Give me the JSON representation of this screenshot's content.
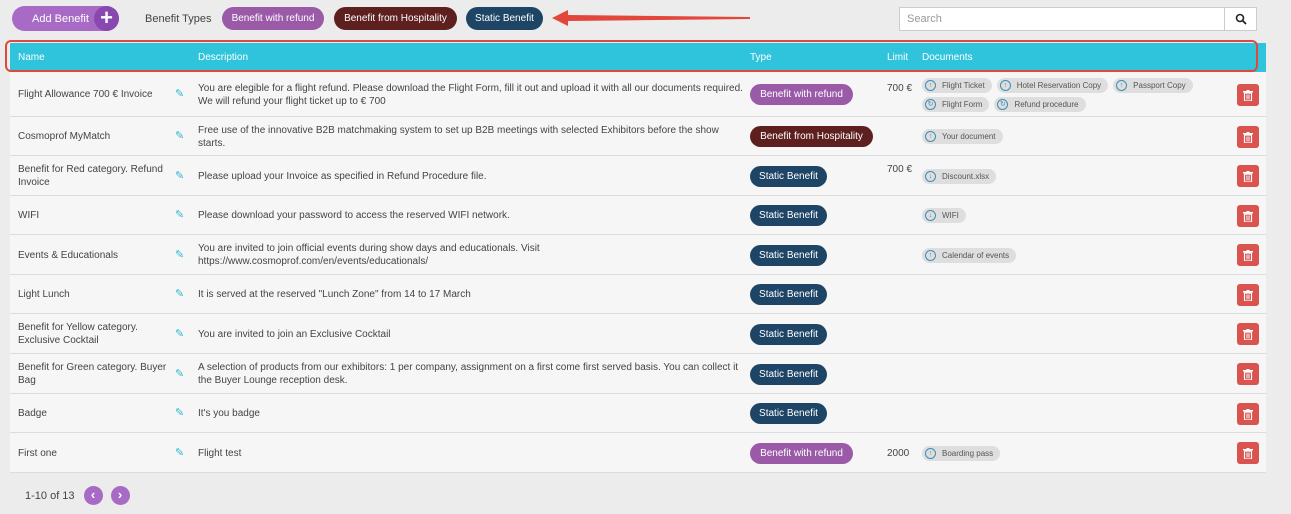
{
  "toolbar": {
    "add_label": "Add Benefit",
    "types_label": "Benefit Types",
    "type_pills": [
      "Benefit with refund",
      "Benefit from Hospitality",
      "Static Benefit"
    ],
    "search_placeholder": "Search"
  },
  "table": {
    "headers": {
      "name": "Name",
      "description": "Description",
      "type": "Type",
      "limit": "Limit",
      "documents": "Documents"
    },
    "rows": [
      {
        "name": "Flight Allowance 700 € Invoice",
        "description": "You are elegible for a flight refund. Please download the Flight Form, fill it out and upload it with all our documents required. We will refund your flight ticket up to € 700",
        "type": "Benefit with refund",
        "limit": "700 €",
        "documents": [
          "Flight Ticket",
          "Hotel Reservation Copy",
          "Passport Copy",
          "Flight Form",
          "Refund procedure"
        ]
      },
      {
        "name": "Cosmoprof MyMatch",
        "description": "Free use of the innovative B2B matchmaking system to set up B2B meetings with selected Exhibitors before the show starts.",
        "type": "Benefit from Hospitality",
        "limit": "",
        "documents": [
          "Your document"
        ]
      },
      {
        "name": "Benefit for Red category. Refund Invoice",
        "description": "Please upload your Invoice as specified in Refund Procedure file.",
        "type": "Static Benefit",
        "limit": "700 €",
        "documents": [
          "Discount.xlsx"
        ]
      },
      {
        "name": "WIFI",
        "description": "Please download your password to access the reserved WIFI network.",
        "type": "Static Benefit",
        "limit": "",
        "documents": [
          "WIFI"
        ]
      },
      {
        "name": "Events & Educationals",
        "description": "You are invited to join official events during show days and educationals. Visit https://www.cosmoprof.com/en/events/educationals/",
        "type": "Static Benefit",
        "limit": "",
        "documents": [
          "Calendar of events"
        ]
      },
      {
        "name": "Light Lunch",
        "description": "It is served at the reserved \"Lunch Zone\" from 14 to 17 March",
        "type": "Static Benefit",
        "limit": "",
        "documents": []
      },
      {
        "name": "Benefit for Yellow category. Exclusive Cocktail",
        "description": "You are invited to join an Exclusive Cocktail",
        "type": "Static Benefit",
        "limit": "",
        "documents": []
      },
      {
        "name": "Benefit for Green category. Buyer Bag",
        "description": "A selection of products from our exhibitors: 1 per company, assignment on a first come first served basis. You can collect it the Buyer Lounge reception desk.",
        "type": "Static Benefit",
        "limit": "",
        "documents": []
      },
      {
        "name": "Badge",
        "description": "It's you badge",
        "type": "Static Benefit",
        "limit": "",
        "documents": []
      },
      {
        "name": "First one",
        "description": "Flight test",
        "type": "Benefit with refund",
        "limit": "2000",
        "documents": [
          "Boarding pass"
        ]
      }
    ]
  },
  "pagination": {
    "range": "1-10 of 13",
    "prev": "‹",
    "next": "›"
  },
  "colors": {
    "accent": "#2fc4dc",
    "refund": "#9a5aa8",
    "hospitality": "#5e1f1f",
    "static": "#1e4565",
    "delete": "#d9534f",
    "arrow": "#e2473b"
  }
}
